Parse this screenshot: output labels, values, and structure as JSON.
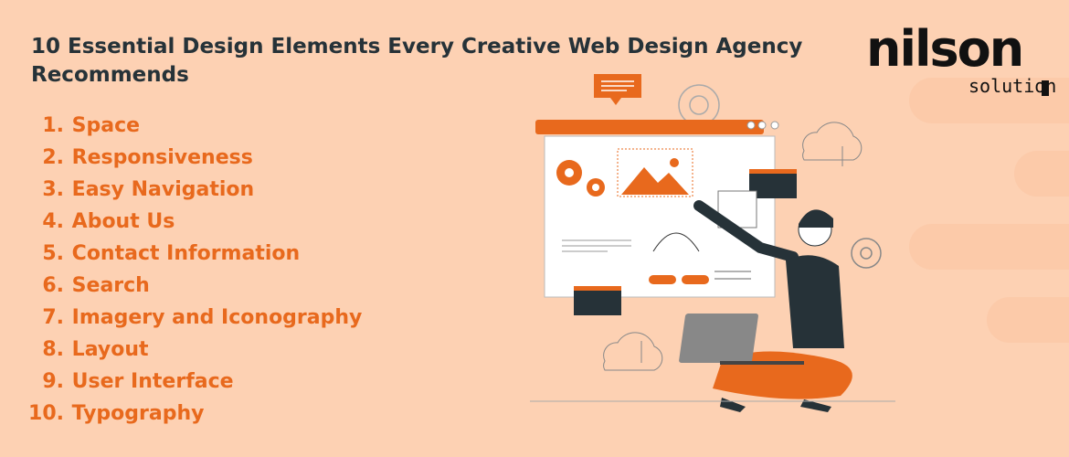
{
  "title": "10 Essential Design Elements Every Creative Web Design Agency Recommends",
  "items": [
    {
      "num": "1.",
      "label": "Space"
    },
    {
      "num": "2.",
      "label": "Responsiveness"
    },
    {
      "num": "3.",
      "label": "Easy Navigation"
    },
    {
      "num": "4.",
      "label": "About Us"
    },
    {
      "num": "5.",
      "label": "Contact Information"
    },
    {
      "num": "6.",
      "label": "Search"
    },
    {
      "num": "7.",
      "label": "Imagery and Iconography"
    },
    {
      "num": "8.",
      "label": "Layout"
    },
    {
      "num": "9.",
      "label": "User Interface"
    },
    {
      "num": "10.",
      "label": "Typography"
    }
  ],
  "logo": {
    "main": "nilson",
    "sub": "solution"
  },
  "colors": {
    "background": "#fdd1b3",
    "accent": "#e8691d",
    "heading": "#263238"
  }
}
